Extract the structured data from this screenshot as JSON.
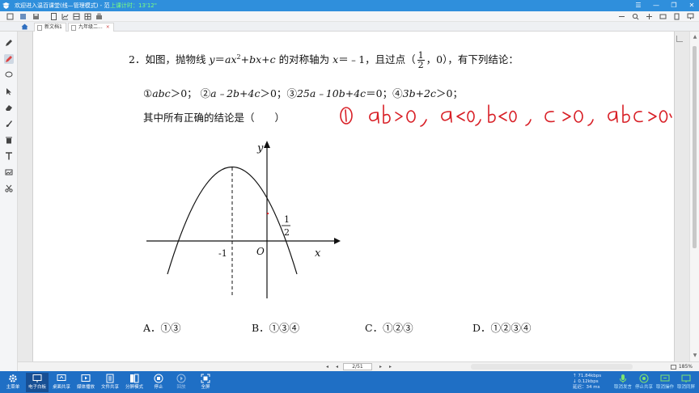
{
  "window": {
    "title": "欢迎进入温百课堂(线—管理模式) - 范",
    "timer_text": "上课计时：13'12\""
  },
  "tabs": [
    {
      "label": "新文档1",
      "active": false
    },
    {
      "label": "九年级二...",
      "active": true,
      "close": "×"
    }
  ],
  "question": {
    "line1_prefix": "2．如图，抛物线 ",
    "eq_y": "y",
    "eq_eq": "＝",
    "eq_a": "ax",
    "eq_sup": "2",
    "eq_plus1": "+",
    "eq_bx": "bx",
    "eq_plus2": "+",
    "eq_c": "c",
    "line1_middle": " 的对称轴为 ",
    "eq_x": "x",
    "line1_axis": "＝﹣1，且过点（",
    "frac_num": "1",
    "frac_den": "2",
    "line1_suffix": "，0），有下列结论：",
    "c1_mark": "①",
    "c1": "abc",
    "c1_rel": "＞0；",
    "c2_mark": "②",
    "c2": "a﹣2b+4c",
    "c2_rel": "＞0；",
    "c3_mark": "③",
    "c3": "25a﹣10b+4c",
    "c3_rel": "＝0；",
    "c4_mark": "④",
    "c4": "3b+2c",
    "c4_rel": "＞0；",
    "line3": "其中所有正确的结论是（　　）"
  },
  "graph": {
    "label_y": "y",
    "label_x": "x",
    "label_o": "O",
    "label_neg1": "-1",
    "label_half_num": "1",
    "label_half_den": "2"
  },
  "annotation": {
    "handwriting": "① ab>0 , a<0 , b<0 , c>0 , abc>0",
    "color": "#d81f26"
  },
  "options": {
    "a": "A．①③",
    "b": "B．①③④",
    "c": "C．①②③",
    "d": "D．①②③④"
  },
  "pagebar": {
    "page": "2/51",
    "zoom": "185%"
  },
  "taskbar": {
    "items": [
      {
        "label": "主菜单",
        "icon": "gear-icon"
      },
      {
        "label": "电子白板",
        "icon": "whiteboard-icon"
      },
      {
        "label": "桌面共享",
        "icon": "desktop-share-icon"
      },
      {
        "label": "媒体播放",
        "icon": "media-play-icon"
      },
      {
        "label": "文件共享",
        "icon": "file-share-icon"
      },
      {
        "label": "分屏模式",
        "icon": "split-screen-icon"
      },
      {
        "label": "停止",
        "icon": "stop-icon"
      },
      {
        "label": "回放",
        "icon": "replay-icon"
      },
      {
        "label": "全屏",
        "icon": "fullscreen-icon"
      }
    ],
    "network": {
      "up": "↑ 71.84kbps",
      "down": "↓ 0.12kbps",
      "latency": "延迟：34 ms"
    },
    "right_items": [
      {
        "label": "取消发言",
        "icon": "mic-icon"
      },
      {
        "label": "停止共享",
        "icon": "stop-share-icon"
      },
      {
        "label": "取消操作",
        "icon": "control-icon"
      },
      {
        "label": "取消同屏",
        "icon": "screen-sync-icon"
      }
    ]
  },
  "colors": {
    "titlebar": "#2f8fdc",
    "taskbar": "#1f6fc5",
    "ink": "#d81f26"
  }
}
